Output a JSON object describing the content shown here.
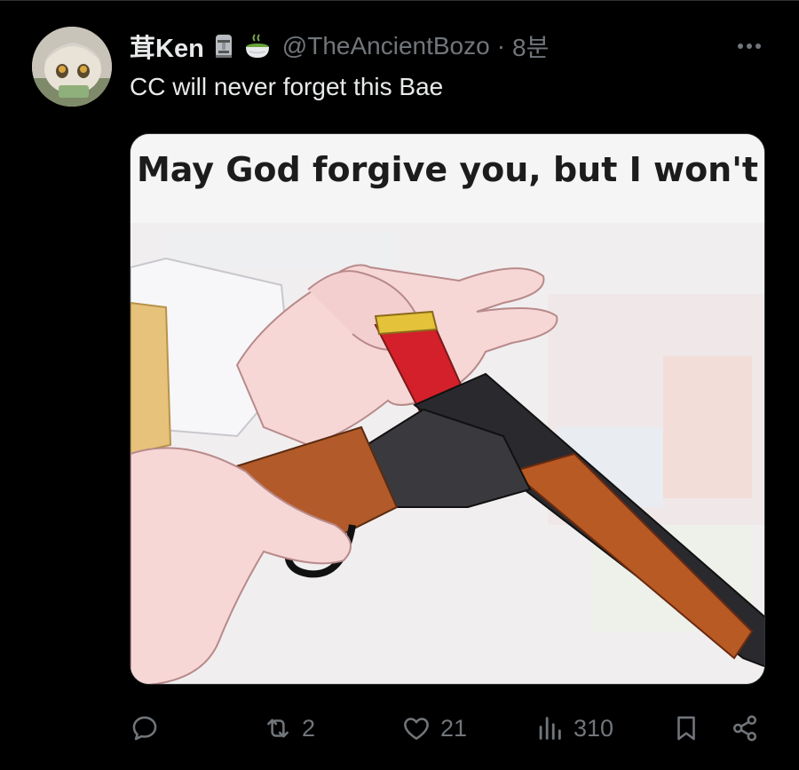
{
  "tweet": {
    "author": {
      "display_name": "茸Ken",
      "emojis": [
        "moai-emoji",
        "green-tea-emoji"
      ],
      "handle": "@TheAncientBozo",
      "separator": "·",
      "time": "8분"
    },
    "text": "CC will never forget this Bae",
    "media": {
      "caption": "May God forgive you, but I won't"
    },
    "actions": {
      "reply": {
        "icon": "reply-icon",
        "count": ""
      },
      "retweet": {
        "icon": "retweet-icon",
        "count": "2"
      },
      "like": {
        "icon": "heart-icon",
        "count": "21"
      },
      "views": {
        "icon": "views-chart-icon",
        "count": "310"
      },
      "bookmark": {
        "icon": "bookmark-icon"
      },
      "share": {
        "icon": "share-icon"
      }
    }
  },
  "colors": {
    "background": "#000000",
    "primary_text": "#e7e9ea",
    "secondary_text": "#71767b",
    "border": "#2f3336"
  }
}
